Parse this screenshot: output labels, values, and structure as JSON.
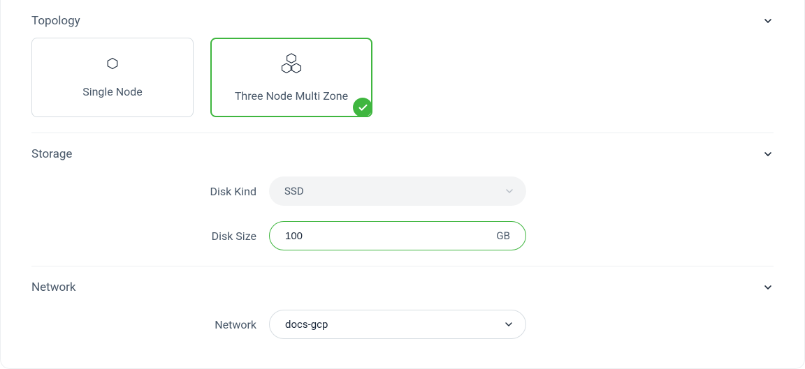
{
  "topology": {
    "title": "Topology",
    "options": {
      "single": "Single Node",
      "multi": "Three Node Multi Zone"
    }
  },
  "storage": {
    "title": "Storage",
    "disk_kind_label": "Disk Kind",
    "disk_kind_value": "SSD",
    "disk_size_label": "Disk Size",
    "disk_size_value": "100",
    "disk_size_unit": "GB"
  },
  "network": {
    "title": "Network",
    "network_label": "Network",
    "network_value": "docs-gcp"
  }
}
